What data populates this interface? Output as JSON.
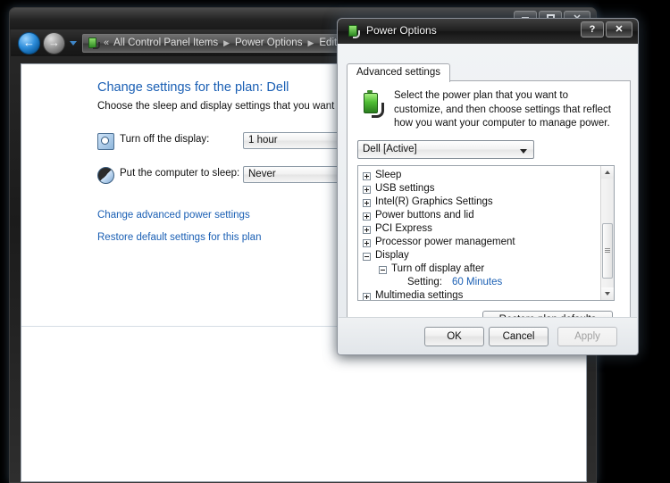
{
  "main_window": {
    "title_buttons": [
      {
        "name": "minimize",
        "glyph": "—"
      },
      {
        "name": "maximize",
        "glyph": "□"
      },
      {
        "name": "close",
        "glyph": "✕"
      }
    ],
    "nav": {
      "back_glyph": "←",
      "forward_glyph": "→",
      "history_dropdown": "▾",
      "address_icon": "power-options-icon",
      "overflow_chevron": "«",
      "breadcrumbs": [
        "All Control Panel Items",
        "Power Options",
        "Edit Plan Settin"
      ],
      "separator": "▶"
    },
    "content": {
      "page_title": "Change settings for the plan: Dell",
      "page_subtitle": "Choose the sleep and display settings that you want your comp",
      "settings": [
        {
          "icon": "clock-icon",
          "label": "Turn off the display:",
          "value": "1 hour"
        },
        {
          "icon": "moon-icon",
          "label": "Put the computer to sleep:",
          "value": "Never"
        }
      ],
      "links": [
        "Change advanced power settings",
        "Restore default settings for this plan"
      ]
    }
  },
  "dialog": {
    "title": "Power Options",
    "icon": "power-plug-battery-icon",
    "title_buttons": [
      {
        "name": "help",
        "glyph": "?"
      },
      {
        "name": "close",
        "glyph": "✕"
      }
    ],
    "tab": "Advanced settings",
    "description": "Select the power plan that you want to customize, and then choose settings that reflect how you want your computer to manage power.",
    "plan_select": {
      "value": "Dell [Active]",
      "caret": "▾"
    },
    "tree": [
      {
        "level": 0,
        "expander": "plus",
        "label": "Sleep"
      },
      {
        "level": 0,
        "expander": "plus",
        "label": "USB settings"
      },
      {
        "level": 0,
        "expander": "plus",
        "label": "Intel(R) Graphics Settings"
      },
      {
        "level": 0,
        "expander": "plus",
        "label": "Power buttons and lid"
      },
      {
        "level": 0,
        "expander": "plus",
        "label": "PCI Express"
      },
      {
        "level": 0,
        "expander": "plus",
        "label": "Processor power management"
      },
      {
        "level": 0,
        "expander": "minus",
        "label": "Display"
      },
      {
        "level": 1,
        "expander": "minus",
        "label": "Turn off display after"
      },
      {
        "level": 2,
        "expander": "none",
        "label": "Setting:",
        "value": "60 Minutes"
      },
      {
        "level": 0,
        "expander": "plus",
        "label": "Multimedia settings"
      }
    ],
    "restore_button": "Restore plan defaults",
    "footer_buttons": {
      "ok": "OK",
      "cancel": "Cancel",
      "apply": "Apply"
    }
  },
  "colors": {
    "link": "#1a5fb4",
    "title_text": "#1a5fb4",
    "desktop": "#000000"
  }
}
